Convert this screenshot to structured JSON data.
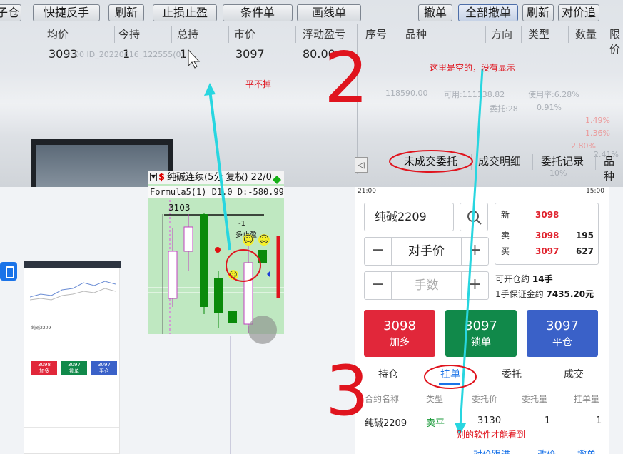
{
  "desktop": {
    "toolbar_left": [
      "子仓",
      "快捷反手",
      "刷新",
      "止损止盈",
      "条件单",
      "画线单"
    ],
    "toolbar_right": [
      "撤单",
      "全部撤单",
      "刷新",
      "对价追"
    ],
    "position_headers": [
      "均价",
      "今持",
      "总持",
      "市价",
      "浮动盈亏"
    ],
    "position_row": {
      "avg_price": "3093",
      "today": "1",
      "total": "1",
      "market": "3097",
      "pnl": "80.00"
    },
    "order_headers": [
      "序号",
      "品种",
      "方向",
      "类型",
      "数量",
      "限价"
    ],
    "bottom_tabs": [
      "未成交委托",
      "成交明细",
      "委托记录",
      "品种"
    ],
    "ghost_texts": {
      "g1": "00 ID_20220616_122555(0)",
      "g2": "118590.00",
      "g3": "可用:111138.82",
      "g4": "使用率:6.28%",
      "g5": "委托:28",
      "g6": "0.91%",
      "g7": "1.49%",
      "g8": "1.36%",
      "g9": "2.80%",
      "g10": "2.41%",
      "g11": "10%"
    }
  },
  "kline": {
    "title_s": "$",
    "title": "纯碱连续(5分 复权) 22/0",
    "formula": "Formula5(1) D1.0 D:-580.998",
    "price_label": "3103",
    "marker_minus": "-1",
    "marker_text": "多止盈",
    "smiley": "☺"
  },
  "phone": {
    "status_time": "21:00",
    "status_right": "15:00",
    "symbol": "纯碱2209",
    "price_mode": "对手价",
    "qty_placeholder": "手数",
    "minus": "−",
    "plus": "+",
    "quote": {
      "new_label": "新",
      "new_price": "3098",
      "sell_label": "卖",
      "sell_price": "3098",
      "sell_vol": "195",
      "buy_label": "买",
      "buy_price": "3097",
      "buy_vol": "627"
    },
    "open_label": "可开仓约",
    "open_value": "14手",
    "margin_label": "1手保证金约",
    "margin_value": "7435.20元",
    "buttons": [
      {
        "price": "3098",
        "label": "加多",
        "color": "#e1273a"
      },
      {
        "price": "3097",
        "label": "锁单",
        "color": "#11894a"
      },
      {
        "price": "3097",
        "label": "平仓",
        "color": "#3a61c8"
      }
    ],
    "tabs": [
      "持仓",
      "挂单",
      "委托",
      "成交"
    ],
    "columns": [
      "合约名称",
      "类型",
      "委托价",
      "委托量",
      "挂单量"
    ],
    "row": {
      "name": "纯碱2209",
      "type": "卖平",
      "price": "3130",
      "qty": "1",
      "pending": "1"
    },
    "bottom_links": [
      "对价跟进",
      "改价",
      "撤单"
    ]
  },
  "thumb": {
    "symbol": "纯碱2209",
    "buttons": [
      "3098",
      "3097",
      "3097"
    ],
    "labels": [
      "加多",
      "锁单",
      "平仓"
    ]
  },
  "annotations": {
    "num2": "2",
    "num3": "3",
    "flat": "平不掉",
    "empty_note": "这里是空的，没有显示",
    "other_soft": "别的软件才能看到"
  }
}
